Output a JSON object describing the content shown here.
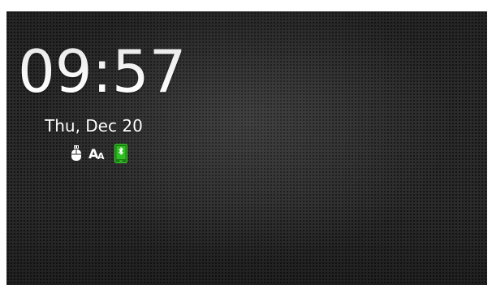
{
  "lockscreen": {
    "time": "09:57",
    "date": "Thu, Dec 20"
  },
  "status_icons": [
    {
      "name": "usb-mouse-icon"
    },
    {
      "name": "font-size-icon",
      "glyph": "AA"
    },
    {
      "name": "bluetooth-phone-icon",
      "color": "#39d12a"
    }
  ],
  "colors": {
    "background": "#2b2b2b",
    "text": "#ffffff",
    "accent": "#39d12a"
  }
}
